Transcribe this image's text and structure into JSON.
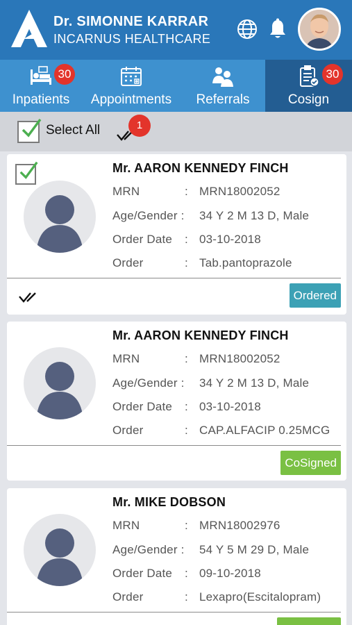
{
  "header": {
    "name": "Dr. SIMONNE KARRAR",
    "org": "INCARNUS HEALTHCARE"
  },
  "tabs": [
    {
      "label": "Inpatients",
      "badge": "30",
      "icon": "bed-icon"
    },
    {
      "label": "Appointments",
      "badge": "",
      "icon": "calendar-icon"
    },
    {
      "label": "Referrals",
      "badge": "",
      "icon": "users-icon"
    },
    {
      "label": "Cosign",
      "badge": "30",
      "icon": "clipboard-check-icon",
      "active": true
    }
  ],
  "select_all": {
    "label": "Select All",
    "checked": true,
    "badge": "1"
  },
  "field_labels": {
    "mrn": "MRN",
    "age": "Age/Gender :",
    "date": "Order Date",
    "order": "Order",
    "colon": ":"
  },
  "cards": [
    {
      "name": "Mr. AARON KENNEDY FINCH",
      "mrn": "MRN18002052",
      "age_gender": "34 Y 2 M 13 D, Male",
      "order_date": "03-10-2018",
      "order": "Tab.pantoprazole",
      "status": "Ordered",
      "checked": true
    },
    {
      "name": "Mr. AARON KENNEDY FINCH",
      "mrn": "MRN18002052",
      "age_gender": "34 Y 2 M 13 D, Male",
      "order_date": "03-10-2018",
      "order": "CAP.ALFACIP 0.25MCG",
      "status": "CoSigned",
      "checked": false
    },
    {
      "name": "Mr. MIKE DOBSON",
      "mrn": "MRN18002976",
      "age_gender": "54 Y 5 M 29 D, Male",
      "order_date": "09-10-2018",
      "order": "Lexapro(Escitalopram)",
      "status": "",
      "checked": false
    }
  ],
  "colors": {
    "header": "#2a77b9",
    "tabs": "#3e91cf",
    "active_tab": "#235d92",
    "badge": "#e3342b",
    "ordered": "#3ca1b5",
    "cosigned": "#7ac043"
  }
}
